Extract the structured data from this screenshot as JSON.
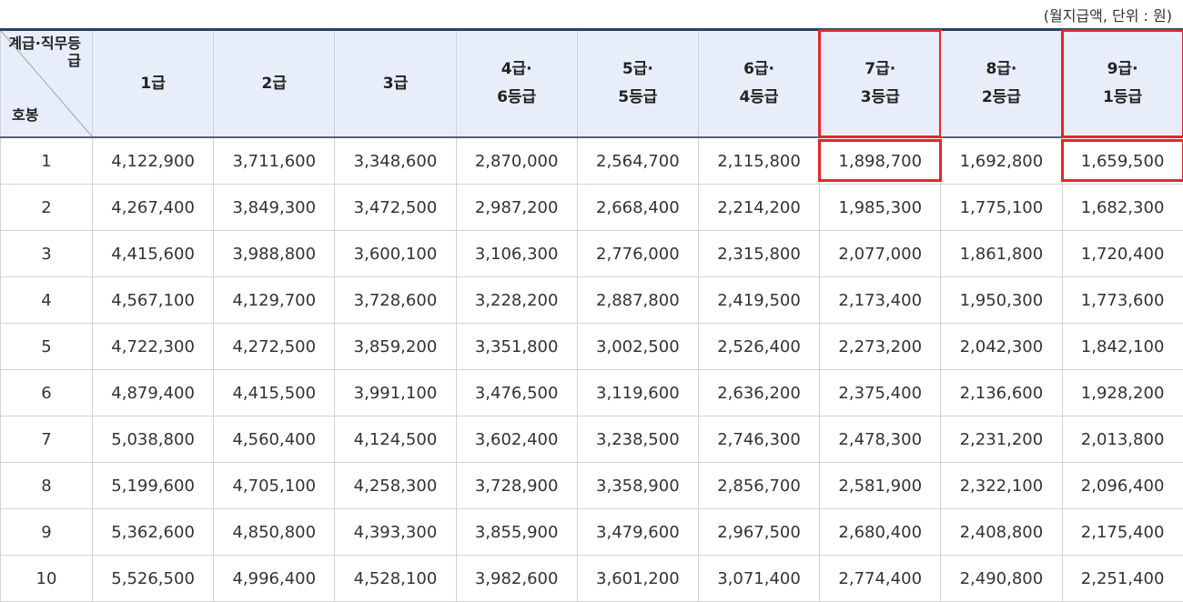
{
  "unit_note": "(월지급액, 단위 : 원)",
  "corner": {
    "top_label": "계급·직무등급",
    "bottom_label": "호봉"
  },
  "grade_headers": [
    {
      "line1": "1급",
      "line2": ""
    },
    {
      "line1": "2급",
      "line2": ""
    },
    {
      "line1": "3급",
      "line2": ""
    },
    {
      "line1": "4급·",
      "line2": "6등급"
    },
    {
      "line1": "5급·",
      "line2": "5등급"
    },
    {
      "line1": "6급·",
      "line2": "4등급"
    },
    {
      "line1": "7급·",
      "line2": "3등급"
    },
    {
      "line1": "8급·",
      "line2": "2등급"
    },
    {
      "line1": "9급·",
      "line2": "1등급"
    }
  ],
  "highlighted_columns": [
    6,
    8
  ],
  "highlight_color": "#e3262d",
  "header_bg_color": "#e8eef9",
  "rows": [
    {
      "step": "1",
      "values": [
        "4,122,900",
        "3,711,600",
        "3,348,600",
        "2,870,000",
        "2,564,700",
        "2,115,800",
        "1,898,700",
        "1,692,800",
        "1,659,500"
      ]
    },
    {
      "step": "2",
      "values": [
        "4,267,400",
        "3,849,300",
        "3,472,500",
        "2,987,200",
        "2,668,400",
        "2,214,200",
        "1,985,300",
        "1,775,100",
        "1,682,300"
      ]
    },
    {
      "step": "3",
      "values": [
        "4,415,600",
        "3,988,800",
        "3,600,100",
        "3,106,300",
        "2,776,000",
        "2,315,800",
        "2,077,000",
        "1,861,800",
        "1,720,400"
      ]
    },
    {
      "step": "4",
      "values": [
        "4,567,100",
        "4,129,700",
        "3,728,600",
        "3,228,200",
        "2,887,800",
        "2,419,500",
        "2,173,400",
        "1,950,300",
        "1,773,600"
      ]
    },
    {
      "step": "5",
      "values": [
        "4,722,300",
        "4,272,500",
        "3,859,200",
        "3,351,800",
        "3,002,500",
        "2,526,400",
        "2,273,200",
        "2,042,300",
        "1,842,100"
      ]
    },
    {
      "step": "6",
      "values": [
        "4,879,400",
        "4,415,500",
        "3,991,100",
        "3,476,500",
        "3,119,600",
        "2,636,200",
        "2,375,400",
        "2,136,600",
        "1,928,200"
      ]
    },
    {
      "step": "7",
      "values": [
        "5,038,800",
        "4,560,400",
        "4,124,500",
        "3,602,400",
        "3,238,500",
        "2,746,300",
        "2,478,300",
        "2,231,200",
        "2,013,800"
      ]
    },
    {
      "step": "8",
      "values": [
        "5,199,600",
        "4,705,100",
        "4,258,300",
        "3,728,900",
        "3,358,900",
        "2,856,700",
        "2,581,900",
        "2,322,100",
        "2,096,400"
      ]
    },
    {
      "step": "9",
      "values": [
        "5,362,600",
        "4,850,800",
        "4,393,300",
        "3,855,900",
        "3,479,600",
        "2,967,500",
        "2,680,400",
        "2,408,800",
        "2,175,400"
      ]
    },
    {
      "step": "10",
      "values": [
        "5,526,500",
        "4,996,400",
        "4,528,100",
        "3,982,600",
        "3,601,200",
        "3,071,400",
        "2,774,400",
        "2,490,800",
        "2,251,400"
      ]
    }
  ]
}
